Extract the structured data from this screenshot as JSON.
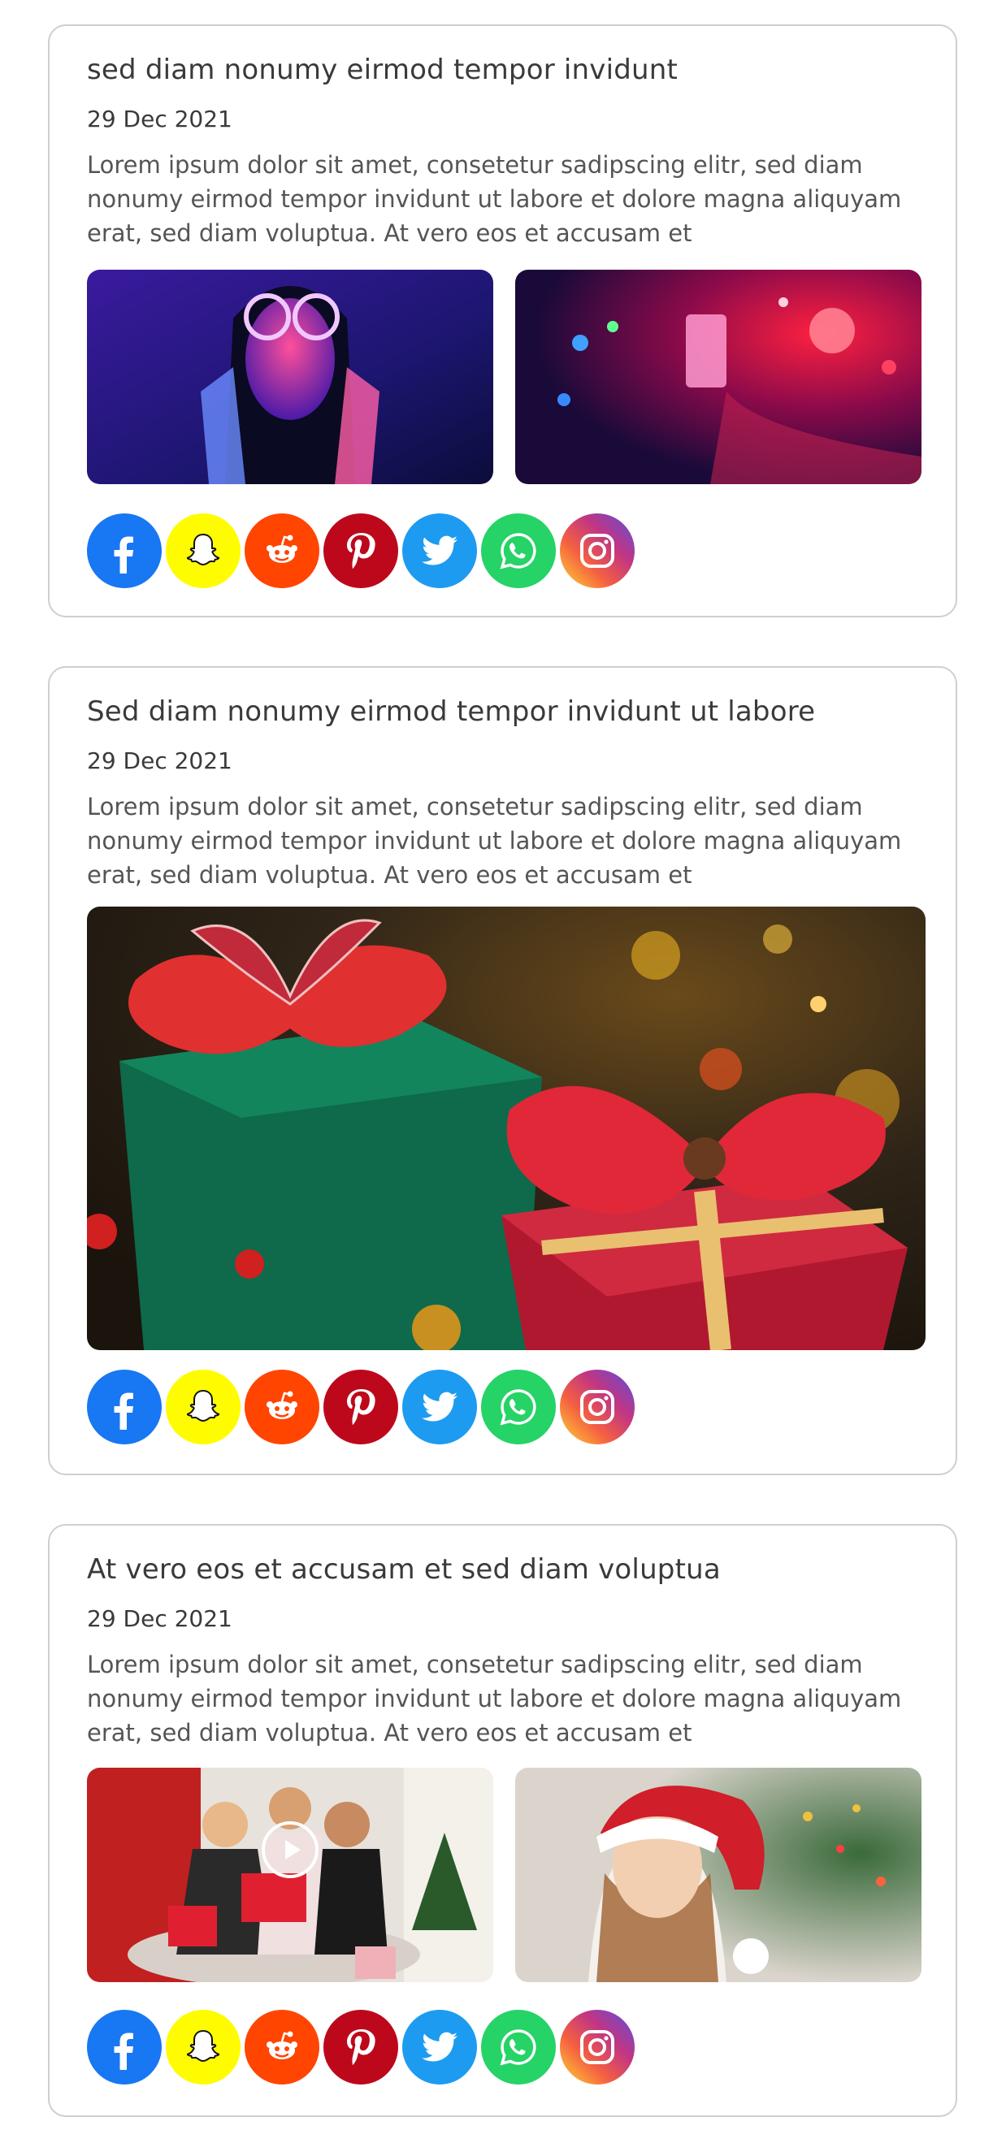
{
  "posts": [
    {
      "title": "sed diam nonumy eirmod tempor invidunt",
      "date": "29 Dec 2021",
      "body": "Lorem ipsum dolor sit amet, consetetur sadipscing elitr, sed diam nonumy eirmod tempor invidunt ut labore et dolore magna aliquyam erat, sed diam voluptua. At vero eos et accusam et"
    },
    {
      "title": "Sed diam nonumy eirmod tempor invidunt ut labore",
      "date": "29 Dec 2021",
      "body": "Lorem ipsum dolor sit amet, consetetur sadipscing elitr, sed diam nonumy eirmod tempor invidunt ut labore et dolore magna aliquyam erat, sed diam voluptua. At vero eos et accusam et"
    },
    {
      "title": "At vero eos et accusam et sed diam voluptua",
      "date": "29 Dec 2021",
      "body": "Lorem ipsum dolor sit amet, consetetur sadipscing elitr, sed diam nonumy eirmod tempor invidunt ut labore et dolore magna aliquyam erat, sed diam voluptua. At vero eos et accusam et"
    }
  ],
  "share_icons": [
    {
      "name": "facebook-icon",
      "color": "#1877f2"
    },
    {
      "name": "snapchat-icon",
      "color": "#fffc00"
    },
    {
      "name": "reddit-icon",
      "color": "#ff4500"
    },
    {
      "name": "pinterest-icon",
      "color": "#bd081c"
    },
    {
      "name": "twitter-icon",
      "color": "#1d9bf0"
    },
    {
      "name": "whatsapp-icon",
      "color": "#25d366"
    },
    {
      "name": "instagram-icon",
      "color": "#c13584"
    }
  ]
}
